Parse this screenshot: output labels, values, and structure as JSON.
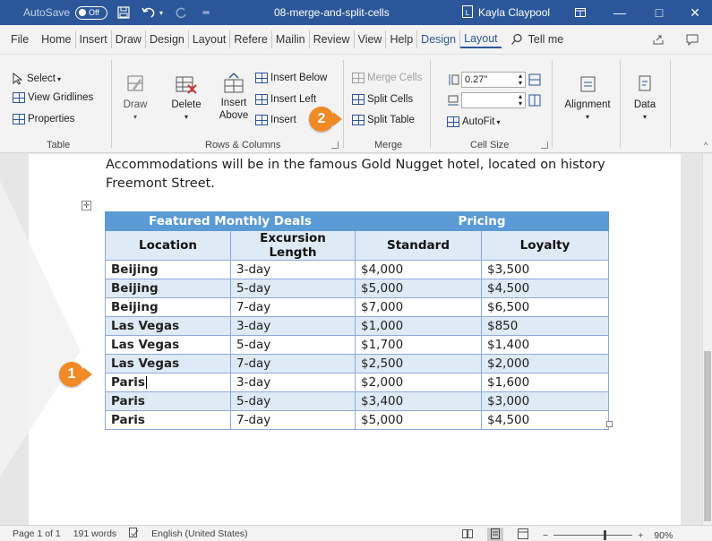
{
  "titlebar": {
    "autosave_label": "AutoSave",
    "autosave_state": "Off",
    "doc_title": "08-merge-and-split-cells",
    "user_name": "Kayla Claypool",
    "win_minimize": "—",
    "win_maximize": "□",
    "win_close": "✕",
    "bg_color": "#2b579a"
  },
  "tabs": [
    "File",
    "Home",
    "Insert",
    "Draw",
    "Design",
    "Layout",
    "Refere",
    "Mailin",
    "Review",
    "View",
    "Help",
    "Design",
    "Layout"
  ],
  "tellme": "Tell me",
  "ribbon": {
    "table_group": {
      "select": "Select",
      "view_gridlines": "View Gridlines",
      "properties": "Properties",
      "label": "Table"
    },
    "draw": "Draw",
    "delete": "Delete",
    "insert_above_1": "Insert",
    "insert_above_2": "Above",
    "insert_below": "Insert Below",
    "insert_left": "Insert Left",
    "insert_right": "Insert",
    "rows_columns_label": "Rows & Columns",
    "merge_cells": "Merge Cells",
    "split_cells": "Split Cells",
    "split_table": "Split Table",
    "merge_label": "Merge",
    "height_value": "0.27\"",
    "width_value": "",
    "autofit": "AutoFit",
    "cell_size_label": "Cell Size",
    "alignment": "Alignment",
    "data": "Data"
  },
  "callouts": {
    "one": "1",
    "two": "2",
    "color": "#ef8a27"
  },
  "document": {
    "paragraph": "Accommodations will be in the famous Gold Nugget hotel, located on history Freemont Street.",
    "table": {
      "header1": [
        "Featured Monthly Deals",
        "Pricing"
      ],
      "header2": [
        "Location",
        "Excursion Length",
        "Standard",
        "Loyalty"
      ],
      "rows": [
        [
          "Beijing",
          "3-day",
          "$4,000",
          "$3,500"
        ],
        [
          "Beijing",
          "5-day",
          "$5,000",
          "$4,500"
        ],
        [
          "Beijing",
          "7-day",
          "$7,000",
          "$6,500"
        ],
        [
          "Las Vegas",
          "3-day",
          "$1,000",
          "$850"
        ],
        [
          "Las Vegas",
          "5-day",
          "$1,700",
          "$1,400"
        ],
        [
          "Las Vegas",
          "7-day",
          "$2,500",
          "$2,000"
        ],
        [
          "Paris",
          "3-day",
          "$2,000",
          "$1,600"
        ],
        [
          "Paris",
          "5-day",
          "$3,400",
          "$3,000"
        ],
        [
          "Paris",
          "7-day",
          "$5,000",
          "$4,500"
        ]
      ],
      "header_color": "#5b9bd5",
      "band_color": "#deeaf6"
    }
  },
  "statusbar": {
    "page": "Page 1 of 1",
    "words": "191 words",
    "language": "English (United States)",
    "zoom": "90%",
    "zoom_minus": "−",
    "zoom_plus": "+"
  }
}
